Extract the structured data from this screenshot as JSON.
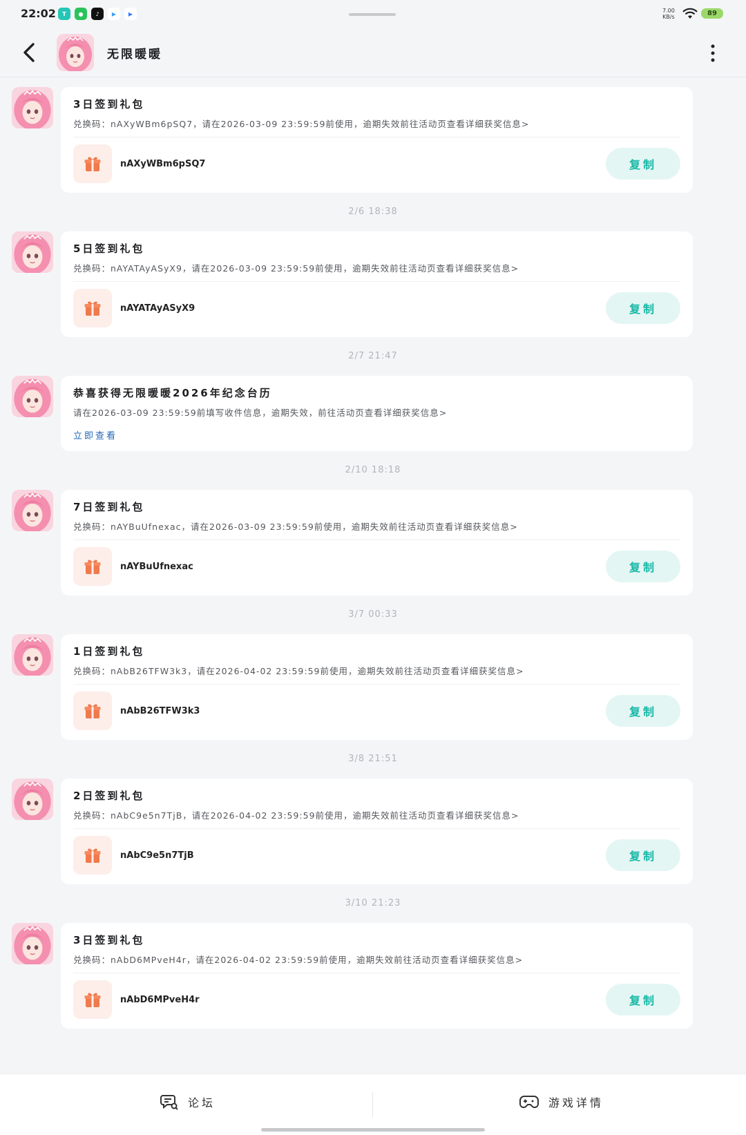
{
  "status": {
    "time": "22:02",
    "net_speed": "7.00\nKB/s",
    "battery": "89"
  },
  "header": {
    "title": "无限暖暖",
    "avatar_icon": "game-avatar",
    "more_icon": "more-vertical-icon",
    "back_icon": "back-arrow-icon"
  },
  "copy_label": "复制",
  "messages": [
    {
      "timestamp": "",
      "title": "3日签到礼包",
      "desc": "兑换码：nAXyWBm6pSQ7，请在2026-03-09 23:59:59前使用，逾期失效前往活动页查看详细获奖信息>",
      "code": "nAXyWBm6pSQ7"
    },
    {
      "timestamp": "2/6   18:38",
      "title": "5日签到礼包",
      "desc": "兑换码：nAYATAyASyX9，请在2026-03-09 23:59:59前使用，逾期失效前往活动页查看详细获奖信息>",
      "code": "nAYATAyASyX9"
    },
    {
      "timestamp": "2/7   21:47",
      "title": "恭喜获得无限暖暖2026年纪念台历",
      "desc": "请在2026-03-09 23:59:59前填写收件信息，逾期失效，前往活动页查看详细获奖信息>",
      "link": "立即查看"
    },
    {
      "timestamp": "2/10   18:18",
      "title": "7日签到礼包",
      "desc": "兑换码：nAYBuUfnexac，请在2026-03-09 23:59:59前使用，逾期失效前往活动页查看详细获奖信息>",
      "code": "nAYBuUfnexac"
    },
    {
      "timestamp": "3/7   00:33",
      "title": "1日签到礼包",
      "desc": "兑换码：nAbB26TFW3k3，请在2026-04-02 23:59:59前使用，逾期失效前往活动页查看详细获奖信息>",
      "code": "nAbB26TFW3k3"
    },
    {
      "timestamp": "3/8   21:51",
      "title": "2日签到礼包",
      "desc": "兑换码：nAbC9e5n7TjB，请在2026-04-02 23:59:59前使用，逾期失效前往活动页查看详细获奖信息>",
      "code": "nAbC9e5n7TjB"
    },
    {
      "timestamp": "3/10   21:23",
      "title": "3日签到礼包",
      "desc": "兑换码：nAbD6MPveH4r，请在2026-04-02 23:59:59前使用，逾期失效前往活动页查看详细获奖信息>",
      "code": "nAbD6MPveH4r"
    }
  ],
  "bottom_nav": [
    {
      "label": "论坛",
      "icon": "forum-chat-icon"
    },
    {
      "label": "游戏详情",
      "icon": "gamepad-icon"
    }
  ],
  "colors": {
    "accent": "#17b8a6",
    "copy_bg": "#e3f6f4",
    "gift_bg": "#fdeee9",
    "gift": "#f07a4d",
    "link": "#2467b8"
  }
}
